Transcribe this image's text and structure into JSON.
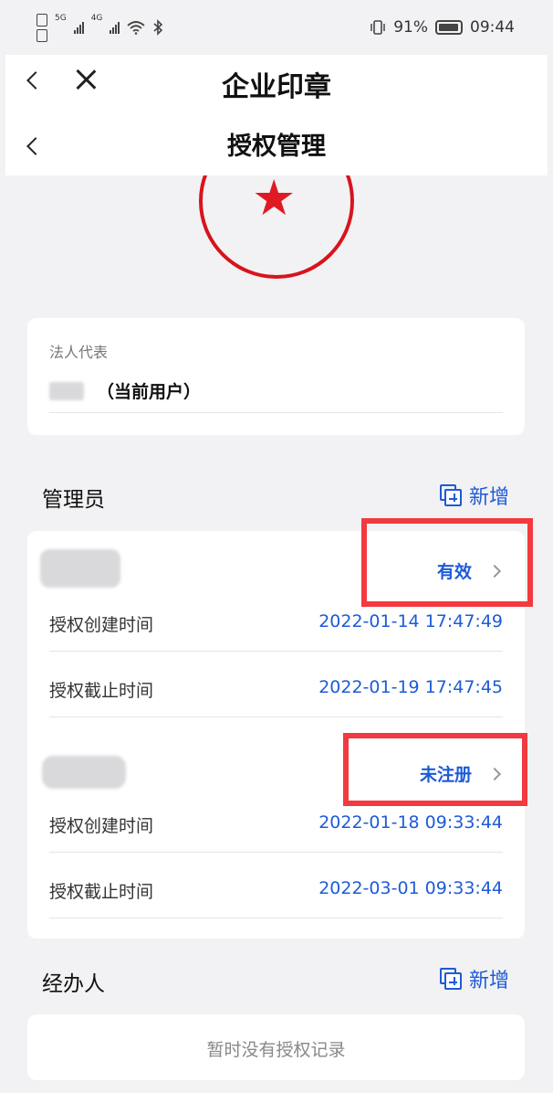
{
  "status_bar": {
    "battery_percent": "91%",
    "time": "09:44",
    "net_5g": "5G",
    "net_4g": "4G"
  },
  "nav_primary": {
    "title": "企业印章"
  },
  "nav_secondary": {
    "title": "授权管理"
  },
  "legal_rep": {
    "label": "法人代表",
    "name_suffix": "（当前用户）"
  },
  "admins": {
    "title": "管理员",
    "add_label": "新增",
    "items": [
      {
        "status": "有效",
        "created_label": "授权创建时间",
        "created_value": "2022-01-14 17:47:49",
        "expiry_label": "授权截止时间",
        "expiry_value": "2022-01-19 17:47:45"
      },
      {
        "status": "未注册",
        "created_label": "授权创建时间",
        "created_value": "2022-01-18 09:33:44",
        "expiry_label": "授权截止时间",
        "expiry_value": "2022-03-01 09:33:44"
      }
    ]
  },
  "agents": {
    "title": "经办人",
    "add_label": "新增",
    "empty_text": "暂时没有授权记录"
  },
  "colors": {
    "accent": "#1d5bd8",
    "seal_red": "#d8141c",
    "highlight_red": "#f23a3f",
    "background": "#f2f2f4"
  }
}
